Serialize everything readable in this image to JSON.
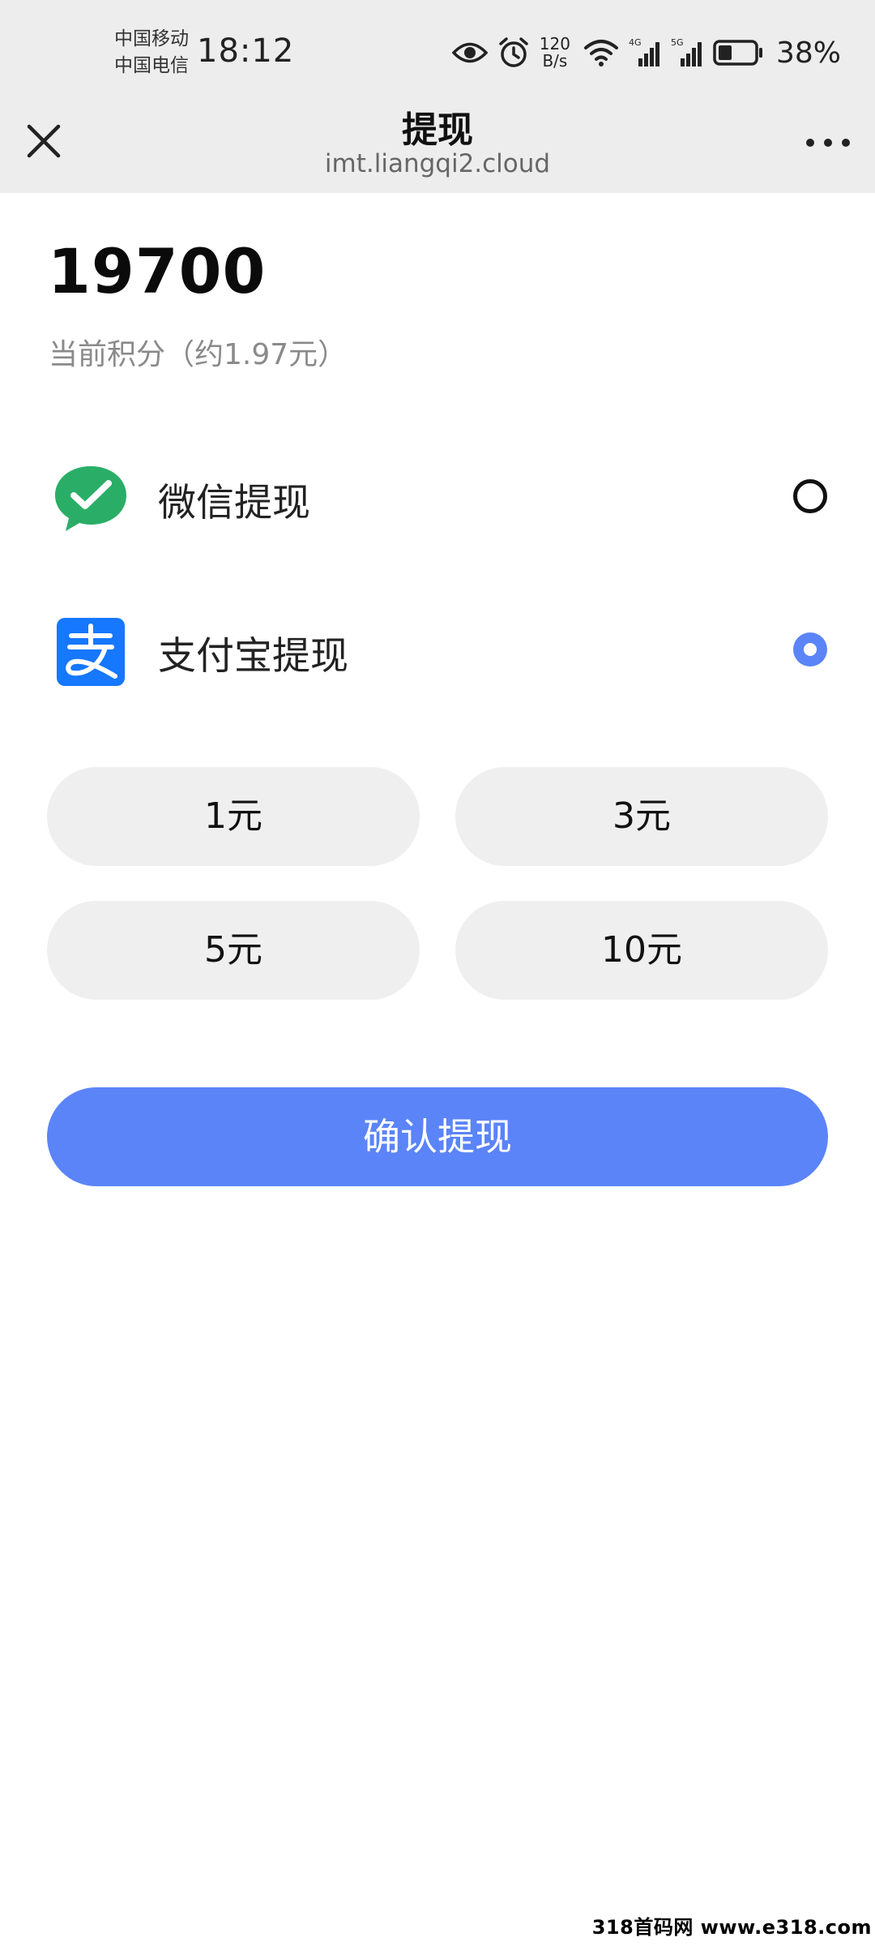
{
  "status_bar": {
    "carrier_1": "中国移动",
    "carrier_2": "中国电信",
    "time": "18:12",
    "net_speed_value": "120",
    "net_speed_unit": "B/s",
    "signal_1_label": "4G",
    "signal_2_label": "5G",
    "battery_percent": "38%",
    "battery_level": 0.38
  },
  "nav": {
    "title": "提现",
    "url": "imt.liangqi2.cloud",
    "close_icon": "close-icon",
    "more_icon": "more-icon"
  },
  "balance": {
    "points": "19700",
    "subtitle": "当前积分（约1.97元）"
  },
  "methods": [
    {
      "label": "微信提现",
      "icon": "wechat-icon",
      "selected": false
    },
    {
      "label": "支付宝提现",
      "icon": "alipay-icon",
      "selected": true
    }
  ],
  "amounts": [
    "1元",
    "3元",
    "5元",
    "10元"
  ],
  "confirm_label": "确认提现",
  "watermark": "318首码网 www.e318.com",
  "colors": {
    "accent": "#5b84f9",
    "wechat_green": "#2aae67",
    "alipay_blue": "#1677ff",
    "option_bg": "#efefef",
    "header_bg": "#ededed"
  }
}
